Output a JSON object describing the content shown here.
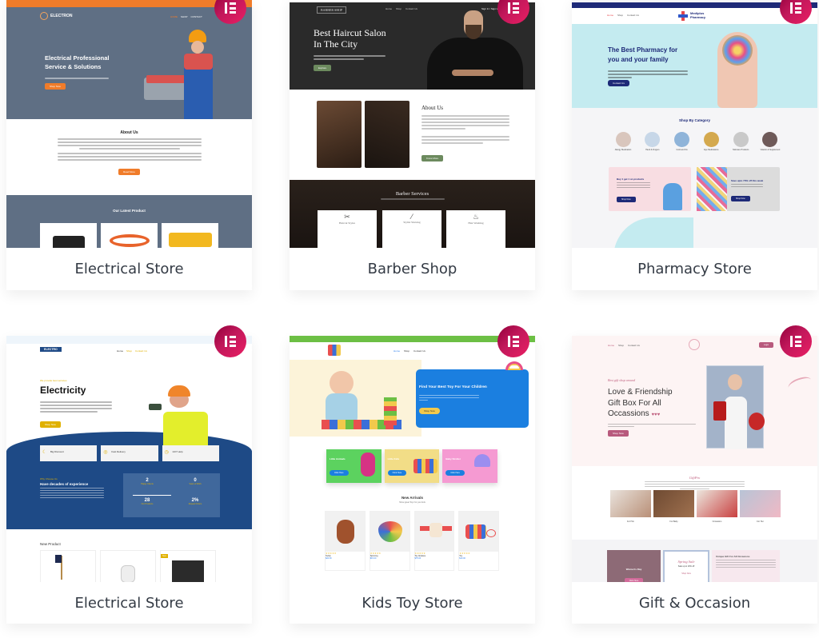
{
  "templates": [
    {
      "title": "Electrical Store",
      "theme": "electrical-1",
      "badge_icon": "elementor-icon",
      "preview": {
        "topbar_color": "#f07c2a",
        "brand": "ELECTRON",
        "nav": [
          "HOME",
          "SHOP",
          "CONTACT"
        ],
        "hero_bg": "#5f6f84",
        "hero_title_line1": "Electrical Professional",
        "hero_title_line2": "Service & Solutions",
        "hero_button": "Shop Now",
        "about_title": "About Us",
        "about_button": "Read More",
        "products_title": "Our Latest Product"
      }
    },
    {
      "title": "Barber Shop",
      "theme": "barber",
      "badge_icon": "elementor-icon",
      "preview": {
        "brand": "BARBER SHOP",
        "nav": [
          "Home",
          "Shop",
          "Contact Us"
        ],
        "signin": "Sign In / Sign Up",
        "hero_title_line1": "Best Haircut Salon",
        "hero_title_line2": "In The City",
        "hero_button": "Explore",
        "about_title": "About Us",
        "about_button": "Know More",
        "services_title": "Barber Services",
        "services": [
          "Haircut Styles",
          "Stylist Shaving",
          "Hair Washing"
        ]
      }
    },
    {
      "title": "Pharmacy Store",
      "theme": "pharmacy",
      "badge_icon": "elementor-icon",
      "preview": {
        "brand_line1": "Mediplus",
        "brand_line2": "Pharmacy",
        "nav": [
          "Home",
          "Shop",
          "Contact Us"
        ],
        "hero_title_line1": "The Best Pharmacy for",
        "hero_title_line2": "you and your family",
        "hero_button": "Contact Us",
        "category_title": "Shop By Category",
        "categories": [
          "Allergy Medication",
          "Hand & Fingers",
          "Cold and Flu",
          "Eye Medications",
          "Skincare Products",
          "Vitamin & Supplement"
        ],
        "promo1_title": "Buy 1 get 1 on products",
        "promo2_title": "Save upto 70% off this week",
        "promo_button": "Shop Now"
      }
    },
    {
      "title": "Electrical Store",
      "theme": "electrical-2",
      "badge_icon": "elementor-icon",
      "preview": {
        "brand": "ELECTRO",
        "nav": [
          "Home",
          "Shop",
          "Contact Us"
        ],
        "eyebrow": "We provide best services",
        "hero_title": "Electricity",
        "hero_button": "Shop Now",
        "features": [
          "Big Discount",
          "Fast Delivery",
          "24/7 Help"
        ],
        "why_eyebrow": "Why Choose Us",
        "why_title": "Have decades of experience",
        "stats": [
          {
            "value": "2",
            "label": "Happy Clients"
          },
          {
            "value": "0",
            "label": "Years of Work"
          },
          {
            "value": "28",
            "label": "Our Products"
          },
          {
            "value": "2%",
            "label": "Repeat Orders"
          }
        ],
        "new_product_title": "New Product"
      }
    },
    {
      "title": "Kids Toy Store",
      "theme": "kids",
      "badge_icon": "elementor-icon",
      "preview": {
        "nav": [
          "Home",
          "Shop",
          "Contact Us"
        ],
        "hero_title": "Find Your Best Toy For Your Children",
        "hero_button": "Shop Now",
        "categories": [
          {
            "name": "Little Animals",
            "color": "#5cd25f"
          },
          {
            "name": "Little Kids",
            "color": "#f2dd87"
          },
          {
            "name": "Baby Stroller",
            "color": "#f59ad2"
          }
        ],
        "category_button": "Click Here",
        "arrivals_title": "New Arrivals",
        "arrivals_subtitle": "Show great Toys for your kids",
        "products": [
          {
            "name": "Teddy",
            "price": "$20.00"
          },
          {
            "name": "Spinning",
            "price": "$15.00"
          },
          {
            "name": "Toy Airplane",
            "price": "$75.00"
          },
          {
            "name": "Toy",
            "price": "$10.00"
          }
        ]
      }
    },
    {
      "title": "Gift & Occasion",
      "theme": "gift",
      "badge_icon": "elementor-icon",
      "preview": {
        "nav": [
          "Home",
          "Shop",
          "Contact Us"
        ],
        "login": "Login",
        "eyebrow": "Best gift shop around",
        "hero_title_line1": "Love & Friendship",
        "hero_title_line2": "Gift Box For All",
        "hero_title_line3": "Occassions",
        "hero_button": "Shop Now",
        "brand": "GiftPro",
        "categories": [
          "For Him",
          "For Baby",
          "Occasions",
          "For Her"
        ],
        "promo1_title": "Women's Day",
        "promo1_button": "Click Here",
        "promo2_title": "Spring Sale",
        "promo2_subtitle": "Sale up to 10% off",
        "promo2_link": "Shop Now",
        "promo3_title": "Unique Gift For All Occasions"
      }
    }
  ]
}
